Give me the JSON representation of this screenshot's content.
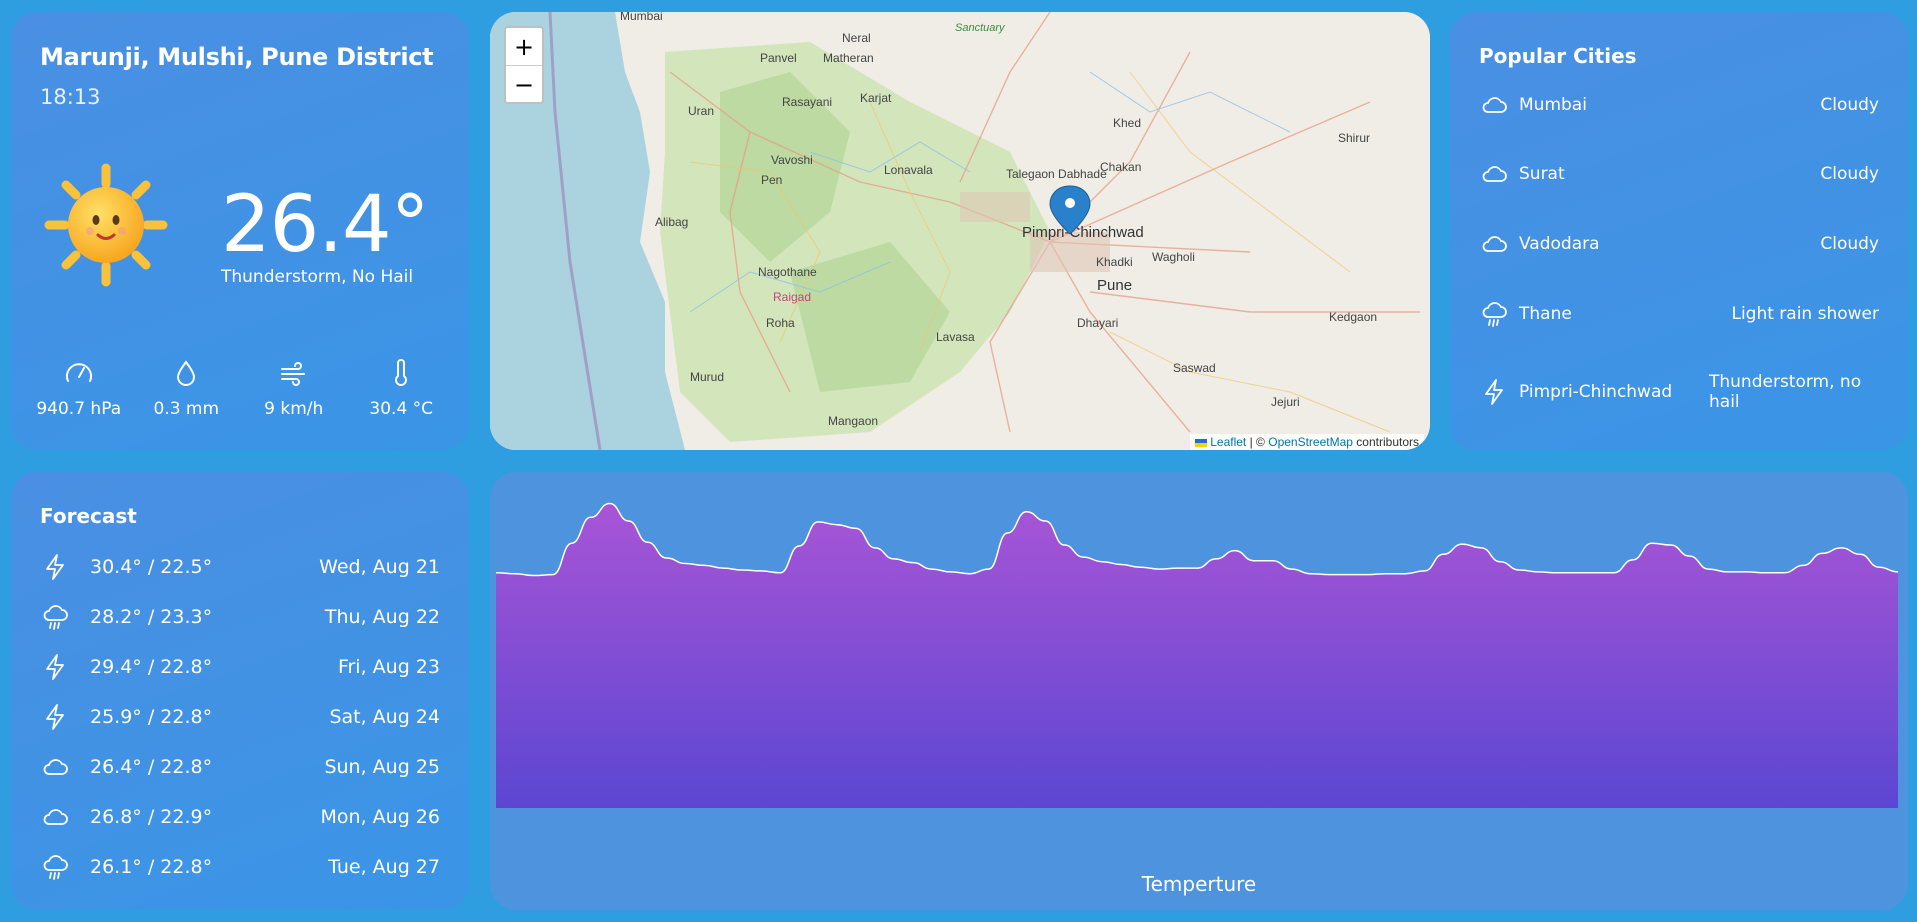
{
  "current": {
    "location": "Marunji, Mulshi, Pune District",
    "time": "18:13",
    "temperature": "26.4°",
    "condition": "Thunderstorm, No Hail",
    "icon": "sun-icon",
    "stats": [
      {
        "icon": "pressure-gauge-icon",
        "value": "940.7 hPa"
      },
      {
        "icon": "droplet-icon",
        "value": "0.3 mm"
      },
      {
        "icon": "wind-icon",
        "value": "9 km/h"
      },
      {
        "icon": "thermometer-icon",
        "value": "30.4 °C"
      }
    ]
  },
  "map": {
    "zoom_in": "+",
    "zoom_out": "−",
    "attribution_leaflet": "Leaflet",
    "attribution_sep": "| ©",
    "attribution_osm": "OpenStreetMap",
    "attribution_tail": "contributors",
    "labels": [
      "Mumbai",
      "Panvel",
      "Matheran",
      "Neral",
      "Uran",
      "Rasayani",
      "Karjat",
      "Vavoshi",
      "Lonavala",
      "Pen",
      "Alibag",
      "Talegaon Dabhade",
      "Chakan",
      "Khed",
      "Shirur",
      "Pimpri-Chinchwad",
      "Khadki",
      "Wagholi",
      "Pune",
      "Nagothane",
      "Raigad",
      "Roha",
      "Lavasa",
      "Dhayari",
      "Kedgaon",
      "Saswad",
      "Murud",
      "Mangaon",
      "Jejuri",
      "Sanctuary"
    ]
  },
  "cities": {
    "title": "Popular Cities",
    "items": [
      {
        "icon": "cloud-icon",
        "name": "Mumbai",
        "condition": "Cloudy"
      },
      {
        "icon": "cloud-icon",
        "name": "Surat",
        "condition": "Cloudy"
      },
      {
        "icon": "cloud-icon",
        "name": "Vadodara",
        "condition": "Cloudy"
      },
      {
        "icon": "rain-cloud-icon",
        "name": "Thane",
        "condition": "Light rain shower"
      },
      {
        "icon": "lightning-icon",
        "name": "Pimpri-Chinchwad",
        "condition": "Thunderstorm, no hail"
      }
    ]
  },
  "forecast": {
    "title": "Forecast",
    "days": [
      {
        "icon": "lightning-icon",
        "temps": "30.4° / 22.5°",
        "date": "Wed, Aug 21"
      },
      {
        "icon": "rain-cloud-icon",
        "temps": "28.2° / 23.3°",
        "date": "Thu, Aug 22"
      },
      {
        "icon": "lightning-icon",
        "temps": "29.4° / 22.8°",
        "date": "Fri, Aug 23"
      },
      {
        "icon": "lightning-icon",
        "temps": "25.9° / 22.8°",
        "date": "Sat, Aug 24"
      },
      {
        "icon": "cloud-icon",
        "temps": "26.4° / 22.8°",
        "date": "Sun, Aug 25"
      },
      {
        "icon": "cloud-icon",
        "temps": "26.8° / 22.9°",
        "date": "Mon, Aug 26"
      },
      {
        "icon": "rain-cloud-icon",
        "temps": "26.1° / 22.8°",
        "date": "Tue, Aug 27"
      }
    ]
  },
  "colors": {
    "card": "#4a90e2",
    "background": "#2e9ee0",
    "area_top": "#a855d6",
    "area_bottom": "#5b46d2"
  },
  "chart_data": {
    "type": "area",
    "title": "Temperture",
    "xlabel": "",
    "ylabel": "",
    "grid": false,
    "series": [
      {
        "values": [
          22.8,
          22.7,
          22.5,
          22.6,
          26.0,
          28.8,
          30.3,
          28.4,
          26.1,
          24.4,
          23.8,
          23.6,
          23.3,
          23.1,
          23.0,
          22.8,
          25.7,
          28.3,
          28.0,
          27.6,
          25.5,
          24.3,
          23.9,
          23.2,
          22.9,
          22.7,
          23.2,
          27.1,
          29.4,
          28.4,
          25.8,
          24.5,
          24.0,
          23.7,
          23.4,
          23.2,
          23.3,
          23.3,
          24.3,
          25.2,
          24.1,
          24.1,
          23.2,
          22.7,
          22.6,
          22.6,
          22.6,
          22.7,
          22.7,
          23.0,
          24.8,
          25.9,
          25.5,
          24.0,
          23.1,
          22.9,
          22.8,
          22.8,
          22.8,
          22.8,
          24.2,
          26.0,
          25.8,
          24.6,
          23.2,
          22.9,
          22.9,
          22.8,
          22.8,
          23.6,
          24.9,
          25.5,
          24.8,
          23.4,
          22.9
        ]
      }
    ]
  }
}
